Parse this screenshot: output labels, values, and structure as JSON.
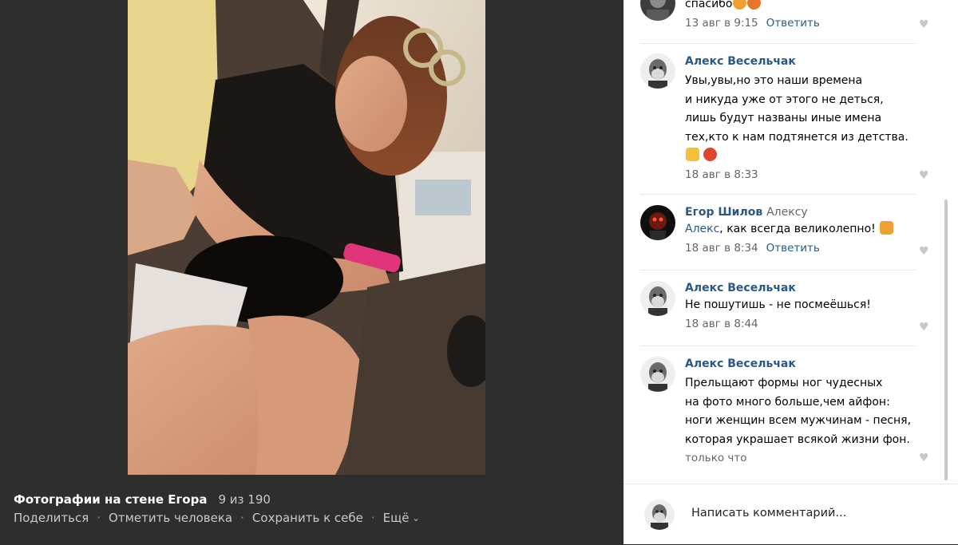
{
  "viewer": {
    "album_title": "Фотографии на стене Егора",
    "counter": "9 из 190",
    "actions": {
      "share": "Поделиться",
      "tag": "Отметить человека",
      "save": "Сохранить к себе",
      "more": "Ещё"
    }
  },
  "comments": [
    {
      "text": "спасибо",
      "date": "13 авг в 9:15",
      "reply": "Ответить",
      "emoji": [
        "face-emoji",
        "face-emoji"
      ]
    },
    {
      "author": "Алекс Весельчак",
      "text": "Увы,увы,но это наши времена\nи никуда уже от этого не деться,\nлишь будут названы иные имена\nтех,кто к нам подтянется из детства.",
      "emoji": [
        "victory-hand-emoji",
        "angry-face-emoji"
      ],
      "date": "18 авг в 8:33"
    },
    {
      "author": "Егор Шилов",
      "addressee": "Алексу",
      "mention": "Алекс",
      "text": ", как всегда великолепно!",
      "emoji": [
        "thumbs-up-emoji"
      ],
      "date": "18 авг в 8:34",
      "reply": "Ответить"
    },
    {
      "author": "Алекс Весельчак",
      "text": "Не пошутишь - не посмеёшься!",
      "date": "18 авг в 8:44"
    },
    {
      "author": "Алекс Весельчак",
      "text": "Прельщают формы ног чудесных\nна фото много больше,чем айфон:\nноги женщин всем мужчинам - песня,\nкоторая украшает всякой жизни фон.",
      "date": "только что"
    }
  ],
  "composer": {
    "placeholder": "Написать комментарий..."
  },
  "colors": {
    "link": "#2a5885",
    "meta": "#656565",
    "backdrop": "#2e2e2e"
  }
}
